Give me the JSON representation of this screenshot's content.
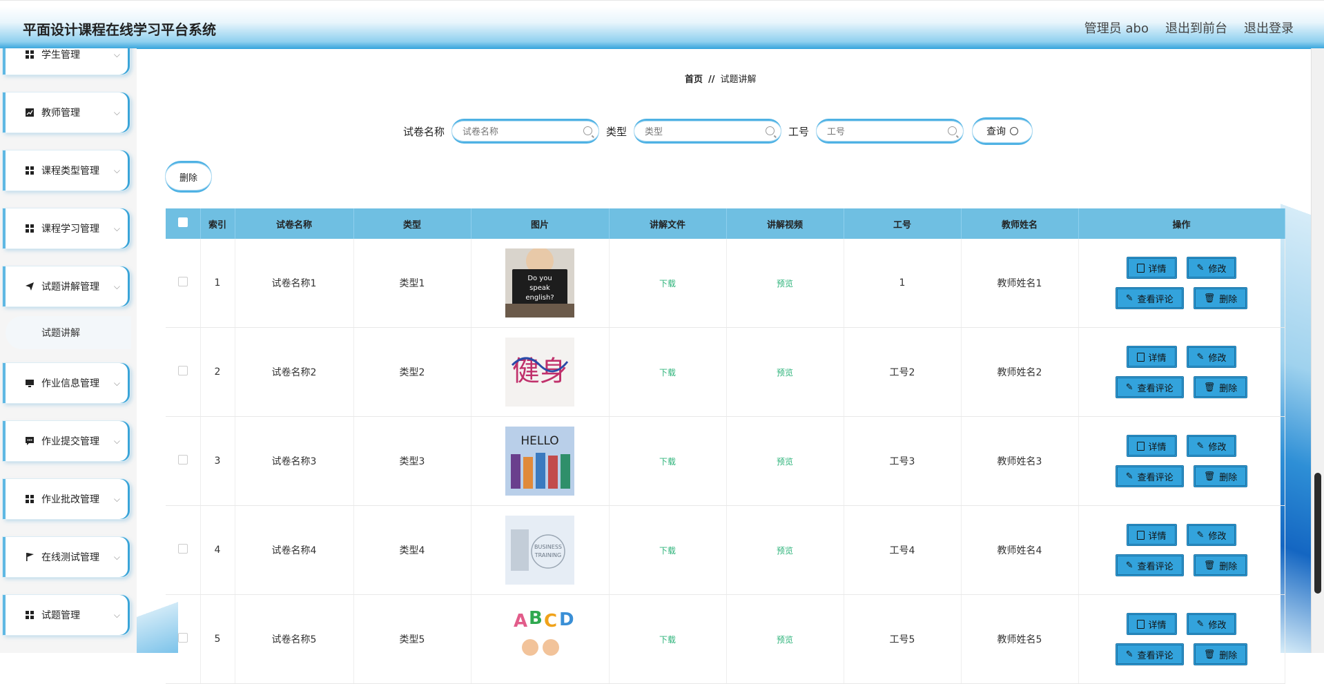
{
  "header": {
    "title": "平面设计课程在线学习平台系统",
    "user": "管理员 abo",
    "to_front": "退出到前台",
    "logout": "退出登录"
  },
  "sidebar": {
    "items": [
      {
        "label": "学生管理",
        "icon": "grid-icon"
      },
      {
        "label": "教师管理",
        "icon": "chart-icon"
      },
      {
        "label": "课程类型管理",
        "icon": "grid-icon"
      },
      {
        "label": "课程学习管理",
        "icon": "grid-icon"
      },
      {
        "label": "试题讲解管理",
        "icon": "send-icon"
      },
      {
        "label": "作业信息管理",
        "icon": "monitor-icon"
      },
      {
        "label": "作业提交管理",
        "icon": "chat-icon"
      },
      {
        "label": "作业批改管理",
        "icon": "grid-icon"
      },
      {
        "label": "在线测试管理",
        "icon": "flag-icon"
      },
      {
        "label": "试题管理",
        "icon": "grid-icon"
      }
    ],
    "sub_item": "试题讲解"
  },
  "breadcrumb": {
    "home": "首页",
    "sep": "//",
    "current": "试题讲解"
  },
  "search": {
    "f1_label": "试卷名称",
    "f1_placeholder": "试卷名称",
    "f2_label": "类型",
    "f2_placeholder": "类型",
    "f3_label": "工号",
    "f3_placeholder": "工号",
    "query_label": "查询"
  },
  "toolbar": {
    "delete_label": "删除"
  },
  "table": {
    "headers": [
      "索引",
      "试卷名称",
      "类型",
      "图片",
      "讲解文件",
      "讲解视频",
      "工号",
      "教师姓名",
      "操作"
    ],
    "rows": [
      {
        "idx": "1",
        "name": "试卷名称1",
        "type": "类型1",
        "file": "下载",
        "video": "预览",
        "no": "1",
        "teacher": "教师姓名1"
      },
      {
        "idx": "2",
        "name": "试卷名称2",
        "type": "类型2",
        "file": "下载",
        "video": "预览",
        "no": "工号2",
        "teacher": "教师姓名2"
      },
      {
        "idx": "3",
        "name": "试卷名称3",
        "type": "类型3",
        "file": "下载",
        "video": "预览",
        "no": "工号3",
        "teacher": "教师姓名3"
      },
      {
        "idx": "4",
        "name": "试卷名称4",
        "type": "类型4",
        "file": "下载",
        "video": "预览",
        "no": "工号4",
        "teacher": "教师姓名4"
      },
      {
        "idx": "5",
        "name": "试卷名称5",
        "type": "类型5",
        "file": "下载",
        "video": "预览",
        "no": "工号5",
        "teacher": "教师姓名5"
      }
    ],
    "ops": {
      "detail": "详情",
      "edit": "修改",
      "comments": "查看评论",
      "delete": "删除"
    },
    "image_texts": [
      "Do you speak english?",
      "健身",
      "HELLO",
      "BUSINESS TRAINING",
      "ABCD"
    ]
  },
  "colors": {
    "accent": "#33a3dc",
    "header_bg": "#6fbfe2",
    "link": "#2db37a"
  }
}
